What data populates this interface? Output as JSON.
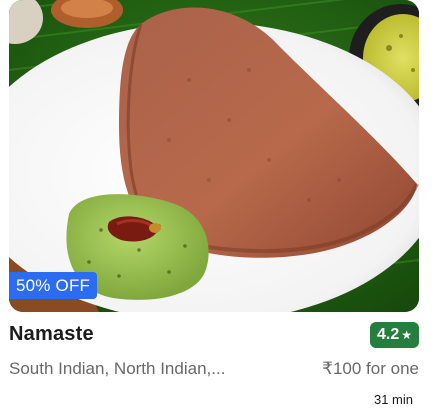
{
  "restaurant": {
    "name": "Namaste",
    "rating": "4.2",
    "rating_star": "★",
    "cuisines": "South Indian, North Indian,...",
    "price": "₹100 for one",
    "delivery_time": "31 min",
    "offer": "50% OFF"
  },
  "image": {
    "subject": "ragi dosa with green chutney on white plate over banana leaf"
  },
  "colors": {
    "rating_bg": "#267e3e",
    "offer_bg": "#2b6cf0",
    "muted_text": "#696969"
  }
}
